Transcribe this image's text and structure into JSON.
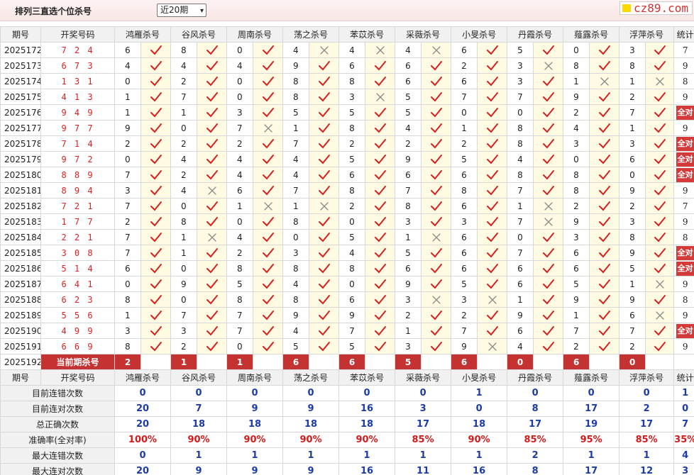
{
  "page": {
    "title": "排列三直选个位杀号",
    "range_select": "近20期",
    "logo_text": "cz89.com"
  },
  "columns": [
    "期号",
    "开奖号码",
    "鸿雁杀号",
    "谷风杀号",
    "周南杀号",
    "荡之杀号",
    "苯苡杀号",
    "采薇杀号",
    "小旻杀号",
    "丹霞杀号",
    "薤露杀号",
    "浮萍杀号",
    "统计"
  ],
  "rows": [
    {
      "issue": "2025172",
      "draw": "724",
      "kills": [
        6,
        8,
        0,
        4,
        4,
        4,
        6,
        5,
        0,
        3
      ],
      "marks": [
        1,
        1,
        1,
        0,
        0,
        0,
        1,
        1,
        1,
        1
      ],
      "count": "7"
    },
    {
      "issue": "2025173",
      "draw": "673",
      "kills": [
        4,
        4,
        4,
        9,
        6,
        6,
        2,
        3,
        8,
        8
      ],
      "marks": [
        1,
        1,
        1,
        1,
        1,
        1,
        1,
        0,
        1,
        1
      ],
      "count": "9"
    },
    {
      "issue": "2025174",
      "draw": "131",
      "kills": [
        0,
        2,
        0,
        8,
        8,
        6,
        6,
        3,
        1,
        1
      ],
      "marks": [
        1,
        1,
        1,
        1,
        1,
        1,
        1,
        1,
        0,
        0
      ],
      "count": "8"
    },
    {
      "issue": "2025175",
      "draw": "413",
      "kills": [
        1,
        7,
        0,
        8,
        3,
        5,
        7,
        7,
        9,
        2
      ],
      "marks": [
        1,
        1,
        1,
        1,
        0,
        1,
        1,
        1,
        1,
        1
      ],
      "count": "9"
    },
    {
      "issue": "2025176",
      "draw": "949",
      "kills": [
        1,
        1,
        3,
        5,
        5,
        5,
        0,
        0,
        2,
        7
      ],
      "marks": [
        1,
        1,
        1,
        1,
        1,
        1,
        1,
        1,
        1,
        1
      ],
      "count": "全对"
    },
    {
      "issue": "2025177",
      "draw": "977",
      "kills": [
        9,
        0,
        7,
        1,
        8,
        4,
        1,
        8,
        4,
        1
      ],
      "marks": [
        1,
        1,
        0,
        1,
        1,
        1,
        1,
        1,
        1,
        1
      ],
      "count": "9"
    },
    {
      "issue": "2025178",
      "draw": "714",
      "kills": [
        2,
        2,
        2,
        7,
        2,
        2,
        2,
        8,
        3,
        3
      ],
      "marks": [
        1,
        1,
        1,
        1,
        1,
        1,
        1,
        1,
        1,
        1
      ],
      "count": "全对"
    },
    {
      "issue": "2025179",
      "draw": "972",
      "kills": [
        0,
        4,
        4,
        4,
        5,
        9,
        5,
        4,
        0,
        6
      ],
      "marks": [
        1,
        1,
        1,
        1,
        1,
        1,
        1,
        1,
        1,
        1
      ],
      "count": "全对"
    },
    {
      "issue": "2025180",
      "draw": "889",
      "kills": [
        7,
        2,
        4,
        4,
        6,
        6,
        6,
        8,
        8,
        0
      ],
      "marks": [
        1,
        1,
        1,
        1,
        1,
        1,
        1,
        1,
        1,
        1
      ],
      "count": "全对"
    },
    {
      "issue": "2025181",
      "draw": "894",
      "kills": [
        3,
        4,
        6,
        7,
        8,
        7,
        8,
        7,
        8,
        9
      ],
      "marks": [
        1,
        0,
        1,
        1,
        1,
        1,
        1,
        1,
        1,
        1
      ],
      "count": "9"
    },
    {
      "issue": "2025182",
      "draw": "721",
      "kills": [
        7,
        0,
        1,
        1,
        2,
        8,
        6,
        1,
        2,
        2
      ],
      "marks": [
        1,
        1,
        0,
        0,
        1,
        1,
        1,
        0,
        1,
        1
      ],
      "count": "7"
    },
    {
      "issue": "2025183",
      "draw": "177",
      "kills": [
        2,
        8,
        0,
        8,
        0,
        3,
        3,
        7,
        9,
        3
      ],
      "marks": [
        1,
        1,
        1,
        1,
        1,
        1,
        1,
        0,
        1,
        1
      ],
      "count": "9"
    },
    {
      "issue": "2025184",
      "draw": "221",
      "kills": [
        7,
        1,
        4,
        0,
        5,
        1,
        6,
        0,
        3,
        8
      ],
      "marks": [
        1,
        0,
        1,
        1,
        1,
        0,
        1,
        1,
        1,
        1
      ],
      "count": "8"
    },
    {
      "issue": "2025185",
      "draw": "308",
      "kills": [
        7,
        1,
        2,
        3,
        4,
        5,
        6,
        7,
        6,
        9
      ],
      "marks": [
        1,
        1,
        1,
        1,
        1,
        1,
        1,
        1,
        1,
        1
      ],
      "count": "全对"
    },
    {
      "issue": "2025186",
      "draw": "514",
      "kills": [
        6,
        0,
        8,
        8,
        8,
        6,
        6,
        6,
        6,
        5
      ],
      "marks": [
        1,
        1,
        1,
        1,
        1,
        1,
        1,
        1,
        1,
        1
      ],
      "count": "全对"
    },
    {
      "issue": "2025187",
      "draw": "641",
      "kills": [
        0,
        9,
        5,
        4,
        0,
        9,
        5,
        6,
        5,
        1
      ],
      "marks": [
        1,
        1,
        1,
        1,
        1,
        1,
        1,
        1,
        1,
        0
      ],
      "count": "9"
    },
    {
      "issue": "2025188",
      "draw": "623",
      "kills": [
        8,
        0,
        8,
        8,
        6,
        3,
        3,
        1,
        9,
        9
      ],
      "marks": [
        1,
        1,
        1,
        1,
        1,
        0,
        0,
        1,
        1,
        1
      ],
      "count": "8"
    },
    {
      "issue": "2025189",
      "draw": "556",
      "kills": [
        1,
        7,
        7,
        9,
        9,
        2,
        2,
        9,
        1,
        6
      ],
      "marks": [
        1,
        1,
        1,
        1,
        1,
        1,
        1,
        1,
        1,
        0
      ],
      "count": "9"
    },
    {
      "issue": "2025190",
      "draw": "499",
      "kills": [
        3,
        3,
        7,
        4,
        7,
        1,
        7,
        6,
        7,
        7
      ],
      "marks": [
        1,
        1,
        1,
        1,
        1,
        1,
        1,
        1,
        1,
        1
      ],
      "count": "全对"
    },
    {
      "issue": "2025191",
      "draw": "669",
      "kills": [
        8,
        2,
        0,
        5,
        5,
        3,
        9,
        4,
        2,
        2
      ],
      "marks": [
        1,
        1,
        1,
        1,
        1,
        1,
        0,
        1,
        1,
        1
      ],
      "count": "9"
    }
  ],
  "current": {
    "issue": "2025192",
    "label": "当前期杀号",
    "kills": [
      2,
      1,
      1,
      6,
      6,
      5,
      6,
      0,
      6,
      0
    ]
  },
  "stats": [
    {
      "label": "目前连错次数",
      "values": [
        "0",
        "0",
        "0",
        "0",
        "0",
        "0",
        "1",
        "0",
        "0",
        "0",
        "1"
      ],
      "pct": false
    },
    {
      "label": "目前连对次数",
      "values": [
        "20",
        "7",
        "9",
        "9",
        "16",
        "3",
        "0",
        "8",
        "17",
        "2",
        "0"
      ],
      "pct": false
    },
    {
      "label": "总正确次数",
      "values": [
        "20",
        "18",
        "18",
        "18",
        "18",
        "17",
        "18",
        "17",
        "19",
        "17",
        "7"
      ],
      "pct": false
    },
    {
      "label": "准确率(全对率)",
      "values": [
        "100%",
        "90%",
        "90%",
        "90%",
        "90%",
        "85%",
        "90%",
        "85%",
        "95%",
        "85%",
        "35%"
      ],
      "pct": true
    },
    {
      "label": "最大连错次数",
      "values": [
        "0",
        "1",
        "1",
        "1",
        "1",
        "1",
        "1",
        "2",
        "1",
        "1",
        "4"
      ],
      "pct": false
    },
    {
      "label": "最大连对次数",
      "values": [
        "20",
        "9",
        "9",
        "9",
        "16",
        "11",
        "16",
        "8",
        "17",
        "12",
        "3"
      ],
      "pct": false
    }
  ],
  "colors": {
    "check": "#d42020",
    "cross": "#8a8a8a",
    "badge": "#d53a3a",
    "current_bg": "#c43232",
    "stat_blue": "#1d3ba8",
    "stat_red": "#d41b1b",
    "mark_bg": "#fffbe2"
  }
}
